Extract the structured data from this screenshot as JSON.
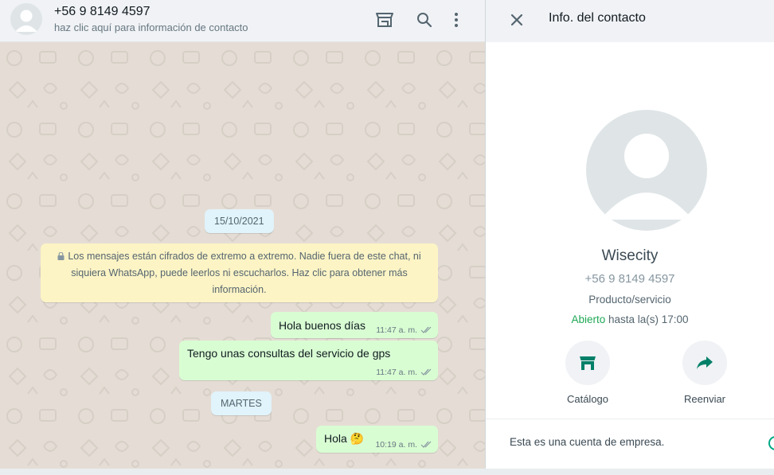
{
  "chat": {
    "contact_title": "+56 9 8149 4597",
    "contact_subtitle": "haz clic aquí para información de contacto",
    "icons": [
      "catalog-icon",
      "search-icon",
      "menu-icon"
    ],
    "date_1": "15/10/2021",
    "encryption_notice": "Los mensajes están cifrados de extremo a extremo. Nadie fuera de este chat, ni siquiera WhatsApp, puede leerlos ni escucharlos. Haz clic para obtener más información.",
    "date_2": "MARTES",
    "messages": [
      {
        "text": "Hola buenos días",
        "time": "11:47 a. m."
      },
      {
        "text": "Tengo unas consultas del servicio de gps",
        "time": "11:47 a. m."
      },
      {
        "text": "Hola 🤔",
        "time": "10:19 a. m."
      }
    ]
  },
  "info": {
    "title": "Info. del contacto",
    "name": "Wisecity",
    "phone": "+56 9 8149 4597",
    "category": "Producto/servicio",
    "open_label": "Abierto",
    "hours_rest": " hasta la(s) 17:00",
    "actions": [
      {
        "label": "Catálogo",
        "icon": "storefront-icon"
      },
      {
        "label": "Reenviar",
        "icon": "forward-icon"
      }
    ],
    "business_note": "Esta es una cuenta de empresa."
  },
  "colors": {
    "outgoing_bubble": "#d9fdd3",
    "system_notice": "#fdf4c5",
    "date_chip": "#e1f3fb",
    "accent_green": "#1fa855",
    "icon_teal": "#008069"
  }
}
